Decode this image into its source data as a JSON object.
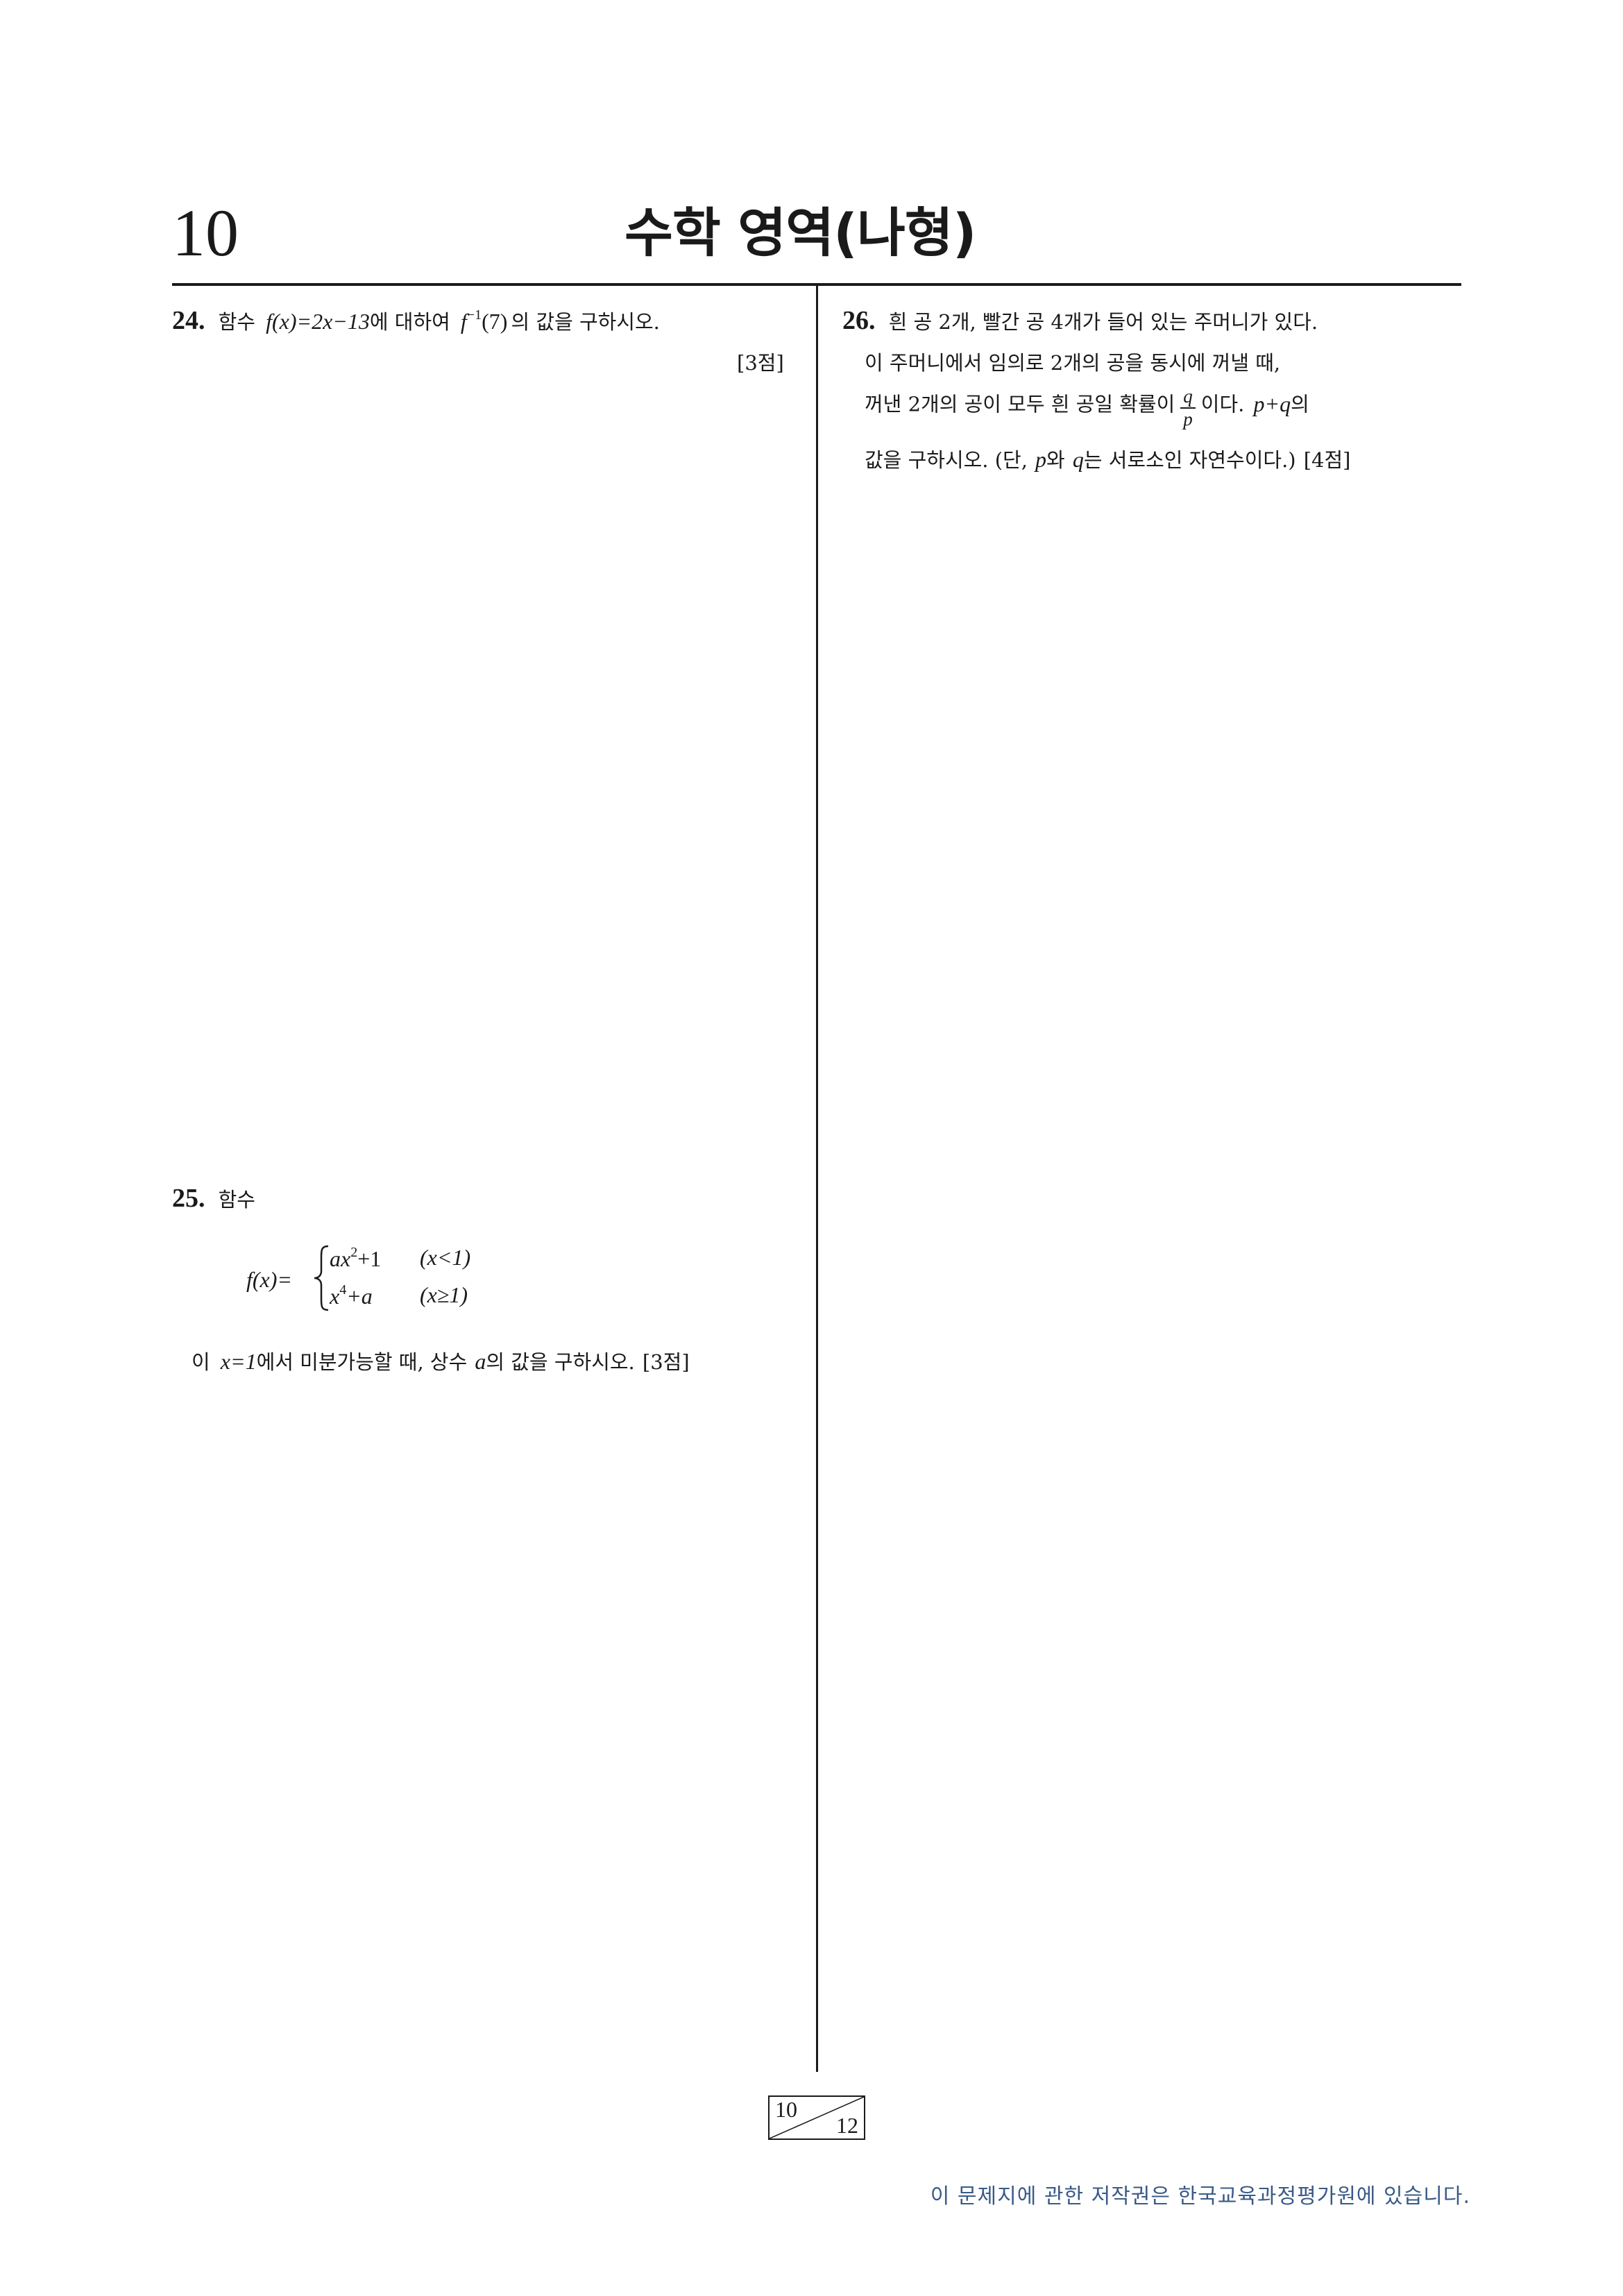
{
  "header": {
    "page_number": "10",
    "title": "수학 영역(나형)"
  },
  "q24": {
    "number": "24.",
    "pre": "함수",
    "func": "f(x)=2x−13",
    "mid": "에 대하여",
    "inv_base": "f",
    "inv_sup": "−1",
    "inv_arg": "(7)",
    "post": "의 값을 구하시오.",
    "points": "[3점]"
  },
  "q25": {
    "number": "25.",
    "pre": "함수",
    "lhs": "f(x)=",
    "case1_expr_a": "ax",
    "case1_expr_sup": "2",
    "case1_expr_b": "+1",
    "case1_cond": "(x<1)",
    "case2_expr_a": "x",
    "case2_expr_sup": "4",
    "case2_expr_b": "+a",
    "case2_cond": "(x≥1)",
    "line2_pre": "이",
    "line2_math": "x=1",
    "line2_mid": "에서 미분가능할 때, 상수",
    "line2_var": "a",
    "line2_post": "의 값을 구하시오.",
    "points": "[3점]"
  },
  "q26": {
    "number": "26.",
    "line1": "흰 공 2개, 빨간 공 4개가 들어 있는 주머니가 있다.",
    "line2": "이 주머니에서 임의로 2개의 공을 동시에 꺼낼 때,",
    "line3_pre": "꺼낸 2개의 공이 모두 흰 공일 확률이",
    "frac_num": "q",
    "frac_den": "p",
    "line3_post": "이다.",
    "line3_math": "p+q",
    "line3_end": "의",
    "line4_pre": "값을 구하시오. (단,",
    "line4_p": "p",
    "line4_mid": "와",
    "line4_q": "q",
    "line4_post": "는 서로소인 자연수이다.)",
    "points": "[4점]"
  },
  "footer": {
    "current_page": "10",
    "total_pages": "12",
    "copyright": "이 문제지에 관한 저작권은 한국교육과정평가원에 있습니다."
  }
}
